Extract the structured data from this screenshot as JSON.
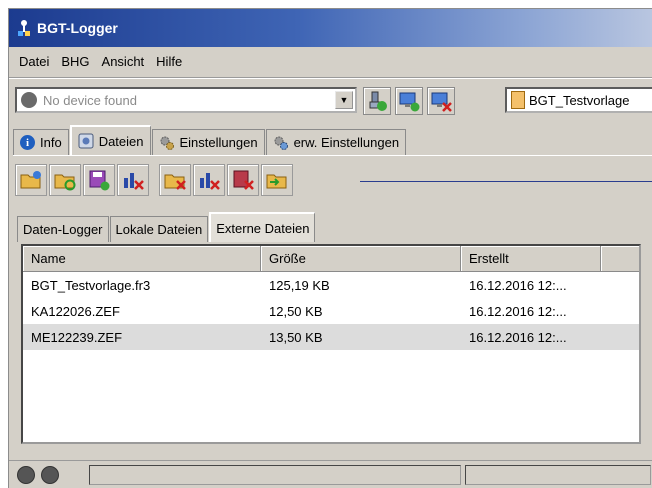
{
  "window": {
    "title": "BGT-Logger"
  },
  "menu": [
    "Datei",
    "BHG",
    "Ansicht",
    "Hilfe"
  ],
  "device": {
    "placeholder": "No device found",
    "template": "BGT_Testvorlage"
  },
  "main_tabs": [
    {
      "label": "Info"
    },
    {
      "label": "Dateien"
    },
    {
      "label": "Einstellungen"
    },
    {
      "label": "erw. Einstellungen"
    }
  ],
  "sub_tabs": [
    "Daten-Logger",
    "Lokale Dateien",
    "Externe Dateien"
  ],
  "file_list": {
    "columns": [
      "Name",
      "Größe",
      "Erstellt"
    ],
    "rows": [
      {
        "name": "BGT_Testvorlage.fr3",
        "size": "125,19 KB",
        "created": "16.12.2016 12:..."
      },
      {
        "name": "KA122026.ZEF",
        "size": "12,50 KB",
        "created": "16.12.2016 12:..."
      },
      {
        "name": "ME122239.ZEF",
        "size": "13,50 KB",
        "created": "16.12.2016 12:..."
      }
    ]
  },
  "colors": {
    "title_start": "#1c3b8f",
    "title_end": "#b9c6e0",
    "face": "#d4d0c8",
    "selected_row": "#dcdcdc"
  }
}
